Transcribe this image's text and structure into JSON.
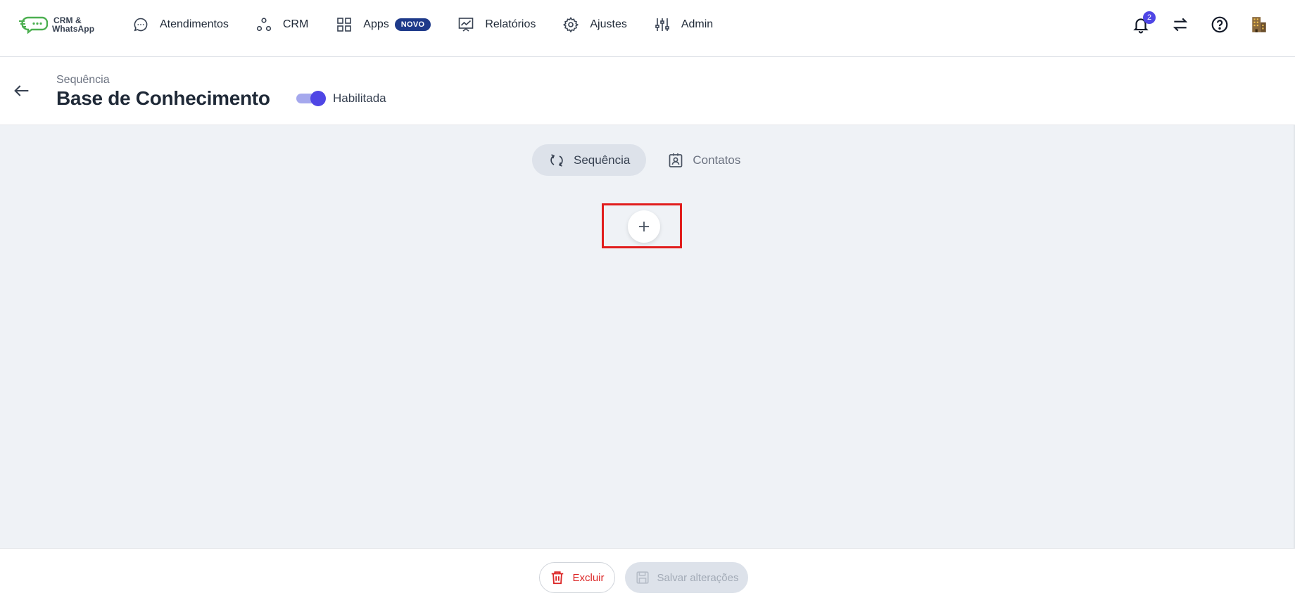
{
  "logo": {
    "line1": "CRM &",
    "line2": "WhatsApp",
    "color": "#4caf50"
  },
  "nav": {
    "items": [
      {
        "label": "Atendimentos",
        "icon": "chat-bubble-icon"
      },
      {
        "label": "CRM",
        "icon": "nodes-icon"
      },
      {
        "label": "Apps",
        "icon": "grid-icon",
        "badge": "NOVO"
      },
      {
        "label": "Relatórios",
        "icon": "chart-board-icon"
      },
      {
        "label": "Ajustes",
        "icon": "gear-icon"
      },
      {
        "label": "Admin",
        "icon": "sliders-icon"
      }
    ]
  },
  "topright": {
    "notification_count": "2"
  },
  "header": {
    "breadcrumb": "Sequência",
    "title": "Base de Conhecimento",
    "toggle_label": "Habilitada",
    "toggle_on": true
  },
  "tabs": [
    {
      "label": "Sequência",
      "icon": "repeat-icon",
      "active": true
    },
    {
      "label": "Contatos",
      "icon": "contact-card-icon",
      "active": false
    }
  ],
  "footer": {
    "delete_label": "Excluir",
    "save_label": "Salvar alterações"
  },
  "colors": {
    "accent": "#4f46e5",
    "badge_bg": "#1e3a8a",
    "danger": "#dc2626",
    "highlight": "#e11d1d",
    "main_bg": "#eff2f6"
  }
}
